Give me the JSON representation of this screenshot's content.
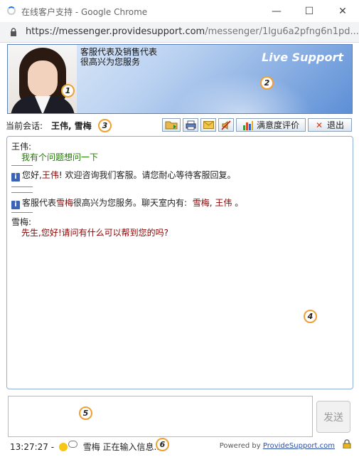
{
  "window": {
    "title": "在线客户支持 - Google Chrome"
  },
  "address": {
    "host": "https://messenger.providesupport.com",
    "path": "/messenger/1lgu6a2pfng6n1pd..."
  },
  "banner": {
    "line1": "客服代表及销售代表",
    "line2": "很高兴为您服务",
    "brand": "Live Support"
  },
  "toolbar": {
    "current_label": "当前会话:",
    "current_names": "王伟, 雪梅",
    "rate_label": "满意度评价",
    "exit_label": "退出"
  },
  "messages": [
    {
      "sender": "王伟:",
      "text": "我有个问题想问一下"
    },
    {
      "text_a": "您好,",
      "name": "王伟",
      "text_b": "! 欢迎咨询我们客服。请您耐心等待客服回复。"
    },
    {
      "text_a": "客服代表",
      "name": "雪梅",
      "text_b": "很高兴为您服务。聊天室内有:",
      "n1": "雪梅",
      "sep": ",",
      "n2": "王伟",
      "end": "。"
    },
    {
      "sender": "雪梅:",
      "text": "先生,您好!请问有什么可以帮到您的吗?"
    }
  ],
  "composer": {
    "send_label": "发送"
  },
  "status": {
    "time": "13:27:27 -",
    "typing_name": "雪梅",
    "typing_text": "正在输入信息...",
    "powered_prefix": "Powered by",
    "powered_link": "ProvideSupport.com"
  },
  "markers": [
    "1",
    "2",
    "3",
    "4",
    "5",
    "6"
  ]
}
